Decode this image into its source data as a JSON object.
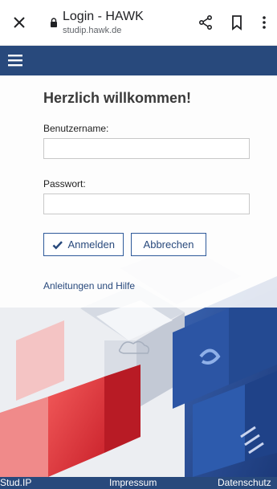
{
  "browser": {
    "page_title": "Login - HAWK",
    "url": "studip.hawk.de",
    "icons": [
      "close-icon",
      "lock-icon",
      "share-icon",
      "bookmark-icon",
      "more-icon"
    ]
  },
  "appbar": {
    "color": "#28497c",
    "menu_icon": "hamburger-menu-icon"
  },
  "login": {
    "heading": "Herzlich willkommen!",
    "username_label": "Benutzername:",
    "username_value": "",
    "password_label": "Passwort:",
    "password_value": "",
    "login_button": "Anmelden",
    "cancel_button": "Abbrechen",
    "help_link": "Anleitungen und Hilfe"
  },
  "footer": {
    "links": [
      "Stud.IP",
      "Impressum",
      "Datenschutz"
    ]
  },
  "colors": {
    "brand_blue": "#28497c",
    "accent_red": "#d9262e"
  }
}
